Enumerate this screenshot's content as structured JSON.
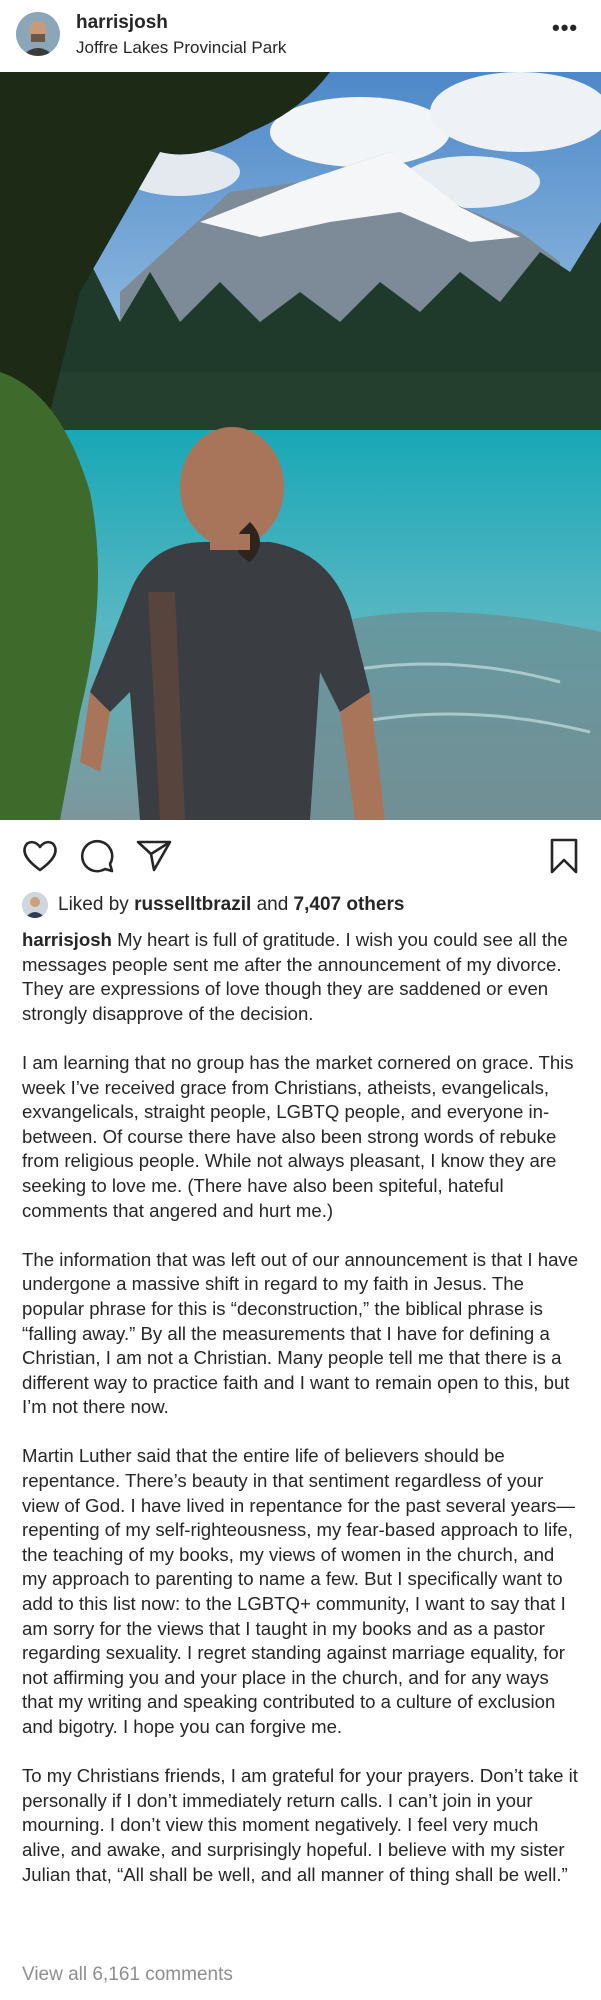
{
  "post": {
    "username": "harrisjosh",
    "location": "Joffre Lakes Provincial Park",
    "more_icon": "ellipsis-icon",
    "image_alt": "Man standing by turquoise mountain lake"
  },
  "actions": {
    "like_icon": "heart-icon",
    "comment_icon": "comment-icon",
    "share_icon": "paper-plane-icon",
    "save_icon": "bookmark-icon"
  },
  "likes": {
    "prefix": "Liked by",
    "user": "russelltbrazil",
    "connector": "and",
    "others": "7,407 others"
  },
  "caption": {
    "username": "harrisjosh",
    "paragraphs": [
      "My heart is full of gratitude. I wish you could see all the messages people sent me after the announcement of my divorce. They are expressions of love though they are saddened or even strongly disapprove of the decision.",
      "I am learning that no group has the market cornered on grace. This week I’ve received grace from Christians, atheists, evangelicals, exvangelicals, straight people, LGBTQ people, and everyone in-between. Of course there have also been strong words of rebuke from religious people. While not always pleasant, I know they are seeking to love me. (There have also been spiteful, hateful comments that angered and hurt me.)",
      "The information that was left out of our announcement is that I have undergone a massive shift in regard to my faith in Jesus. The popular phrase for this is “deconstruction,” the biblical phrase is “falling away.” By all the measurements that I have for defining a Christian, I am not a Christian. Many people tell me that there is a different way to practice faith and I want to remain open to this, but I’m not there now.",
      "Martin Luther said that the entire life of believers should be repentance. There’s beauty in that sentiment regardless of your view of God. I have lived in repentance for the past several years—repenting of my self-righteousness, my fear-based approach to life, the teaching of my books, my views of women in the church, and my approach to parenting to name a few. But I specifically want to add to this list now: to the LGBTQ+ community, I want to say that I am sorry for the views that I taught in my books and as a pastor regarding sexuality. I regret standing against marriage equality, for not affirming you and your place in the church, and for any ways that my writing and speaking contributed to a culture of exclusion and bigotry. I hope you can forgive me.",
      "To my Christians friends, I am grateful for your prayers. Don’t take it personally if I don’t immediately return calls. I can’t join in your mourning. I don’t view this moment negatively. I feel very much alive, and awake, and surprisingly hopeful. I believe with my sister Julian that, “All shall be well, and all manner of thing shall be well.”"
    ]
  },
  "comments": {
    "view_all": "View all 6,161 comments"
  }
}
